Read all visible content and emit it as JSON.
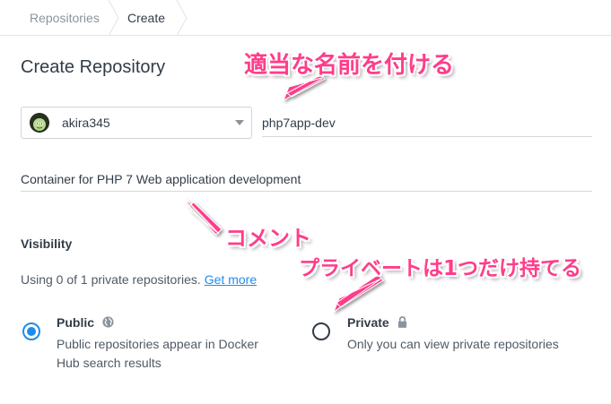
{
  "breadcrumb": {
    "items": [
      "Repositories",
      "Create"
    ]
  },
  "page": {
    "title": "Create Repository"
  },
  "form": {
    "namespace": "akira345",
    "name_value": "php7app-dev",
    "description_value": "Container for PHP 7 Web application development"
  },
  "visibility": {
    "title": "Visibility",
    "usage_text": "Using 0 of 1 private repositories.",
    "get_more": "Get more",
    "public": {
      "label": "Public",
      "desc_line1": "Public repositories appear in Docker",
      "desc_line2": "Hub search results",
      "selected": true
    },
    "private": {
      "label": "Private",
      "desc": "Only you can view private repositories",
      "selected": false
    }
  },
  "annotations": {
    "name_hint": "適当な名前を付ける",
    "comment_hint": "コメント",
    "private_hint": "プライベートは1つだけ持てる",
    "color": "#ff3d8a"
  },
  "colors": {
    "accent": "#1f8ceb",
    "text": "#323c47"
  },
  "icons": {
    "public": "globe-icon",
    "private": "lock-icon",
    "select": "chevron-down-icon"
  }
}
